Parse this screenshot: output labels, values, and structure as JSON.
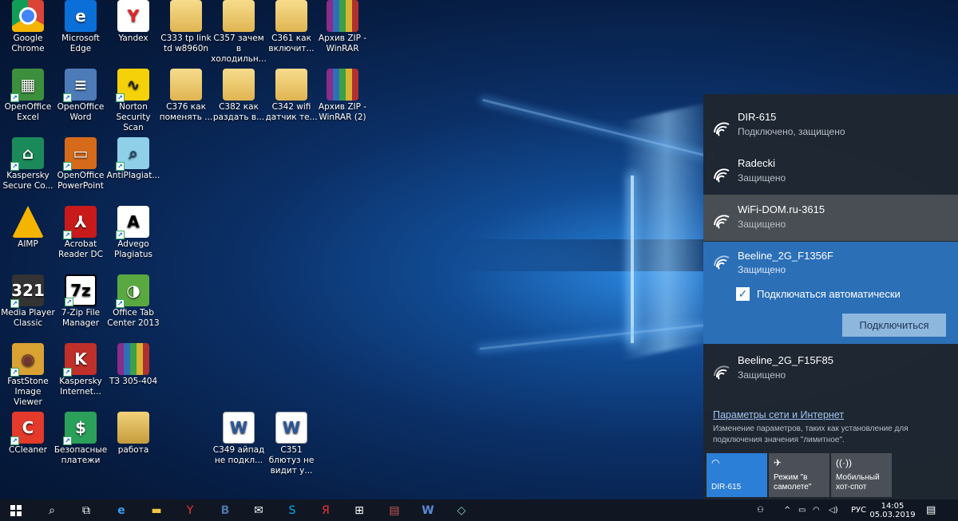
{
  "desktop": {
    "icons": [
      {
        "label": "Google Chrome",
        "icon": "chrome-icon"
      },
      {
        "label": "Microsoft Edge",
        "icon": "edge-icon"
      },
      {
        "label": "Yandex",
        "icon": "yandex-icon"
      },
      {
        "label": "C333 tp link td w8960n",
        "icon": "folder-doc-icon"
      },
      {
        "label": "C357 зачем в холодильн...",
        "icon": "folder-doc-icon"
      },
      {
        "label": "C361 как включит...",
        "icon": "folder-doc-icon"
      },
      {
        "label": "Архив ZIP - WinRAR",
        "icon": "winrar-icon"
      },
      {
        "label": "OpenOffice Excel",
        "icon": "openoffice-calc-icon"
      },
      {
        "label": "OpenOffice Word",
        "icon": "openoffice-writer-icon"
      },
      {
        "label": "Norton Security Scan",
        "icon": "norton-icon"
      },
      {
        "label": "C376 как поменять ...",
        "icon": "folder-doc-icon"
      },
      {
        "label": "C382 как раздать в...",
        "icon": "folder-doc-icon"
      },
      {
        "label": "C342 wifi датчик те...",
        "icon": "folder-doc-icon"
      },
      {
        "label": "Архив ZIP - WinRAR (2)",
        "icon": "winrar-icon"
      },
      {
        "label": "Kaspersky Secure Co...",
        "icon": "kaspersky-secure-icon"
      },
      {
        "label": "OpenOffice PowerPoint",
        "icon": "openoffice-impress-icon"
      },
      {
        "label": "AntiPlagiat...",
        "icon": "antiplagiat-icon"
      },
      {
        "label": "AIMP",
        "icon": "aimp-icon"
      },
      {
        "label": "Acrobat Reader DC",
        "icon": "acrobat-icon"
      },
      {
        "label": "Advego Plagiatus",
        "icon": "advego-icon"
      },
      {
        "label": "Media Player Classic",
        "icon": "mpc-icon"
      },
      {
        "label": "7-Zip File Manager",
        "icon": "7zip-icon"
      },
      {
        "label": "Office Tab Center 2013",
        "icon": "office-tab-icon"
      },
      {
        "label": "FastStone Image Viewer",
        "icon": "faststone-icon"
      },
      {
        "label": "Kaspersky Internet...",
        "icon": "kaspersky-internet-icon"
      },
      {
        "label": "ТЗ 305-404",
        "icon": "winrar-icon"
      },
      {
        "label": "CCleaner",
        "icon": "ccleaner-icon"
      },
      {
        "label": "Безопасные платежи",
        "icon": "safe-money-icon"
      },
      {
        "label": "работа",
        "icon": "folder-icon"
      },
      {
        "label": "C349 айпад не подкл...",
        "icon": "word-doc-icon"
      },
      {
        "label": "C351 блютуз не видит у...",
        "icon": "word-doc-icon"
      }
    ]
  },
  "network_flyout": {
    "networks": [
      {
        "ssid": "DIR-615",
        "status": "Подключено, защищено"
      },
      {
        "ssid": "Radecki",
        "status": "Защищено"
      },
      {
        "ssid": "WiFi-DOM.ru-3615",
        "status": "Защищено"
      },
      {
        "ssid": "Beeline_2G_F15F85",
        "status": "Защищено"
      }
    ],
    "selected": {
      "ssid": "Beeline_2G_F1356F",
      "status": "Защищено",
      "auto_connect_label": "Подключаться автоматически",
      "auto_connect_checked": true,
      "connect_button": "Подключиться"
    },
    "settings_link": "Параметры сети и Интернет",
    "settings_desc": "Изменение параметров, таких как установление для подключения значения \"лимитное\".",
    "quick_actions": [
      {
        "label": "DIR-615",
        "icon": "wifi-icon",
        "active": true
      },
      {
        "label": "Режим \"в самолете\"",
        "icon": "airplane-icon",
        "active": false
      },
      {
        "label": "Мобильный хот-спот",
        "icon": "hotspot-icon",
        "active": false
      }
    ]
  },
  "taskbar": {
    "language": "РУС",
    "time": "14:05",
    "date": "05.03.2019"
  },
  "colors": {
    "accent": "#2b7fd6",
    "flyout_bg": "#1f262f",
    "selected_bg": "#2b6fb7"
  }
}
